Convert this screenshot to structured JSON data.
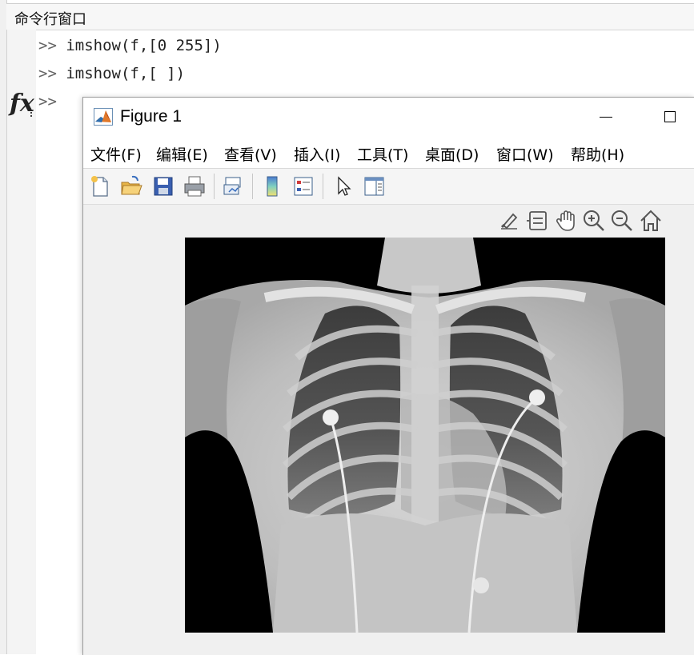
{
  "command_window": {
    "title": "命令行窗口",
    "lines": [
      {
        "prompt": ">>",
        "code": "imshow(f,[0 255])"
      },
      {
        "prompt": ">>",
        "code": "imshow(f,[ ])"
      }
    ],
    "fx_label": "fx",
    "current_prompt": ">>"
  },
  "figure": {
    "title": "Figure 1",
    "menu": [
      "文件(F)",
      "编辑(E)",
      "查看(V)",
      "插入(I)",
      "工具(T)",
      "桌面(D)",
      "窗口(W)",
      "帮助(H)"
    ],
    "toolbar_icons": [
      "new-figure-icon",
      "open-file-icon",
      "save-icon",
      "print-icon",
      "link-plot-icon",
      "colorbar-icon",
      "legend-icon",
      "edit-pointer-icon",
      "property-inspector-icon"
    ],
    "axes_toolbar_icons": [
      "brush-icon",
      "data-tips-icon",
      "pan-icon",
      "zoom-in-icon",
      "zoom-out-icon",
      "restore-view-icon"
    ]
  }
}
